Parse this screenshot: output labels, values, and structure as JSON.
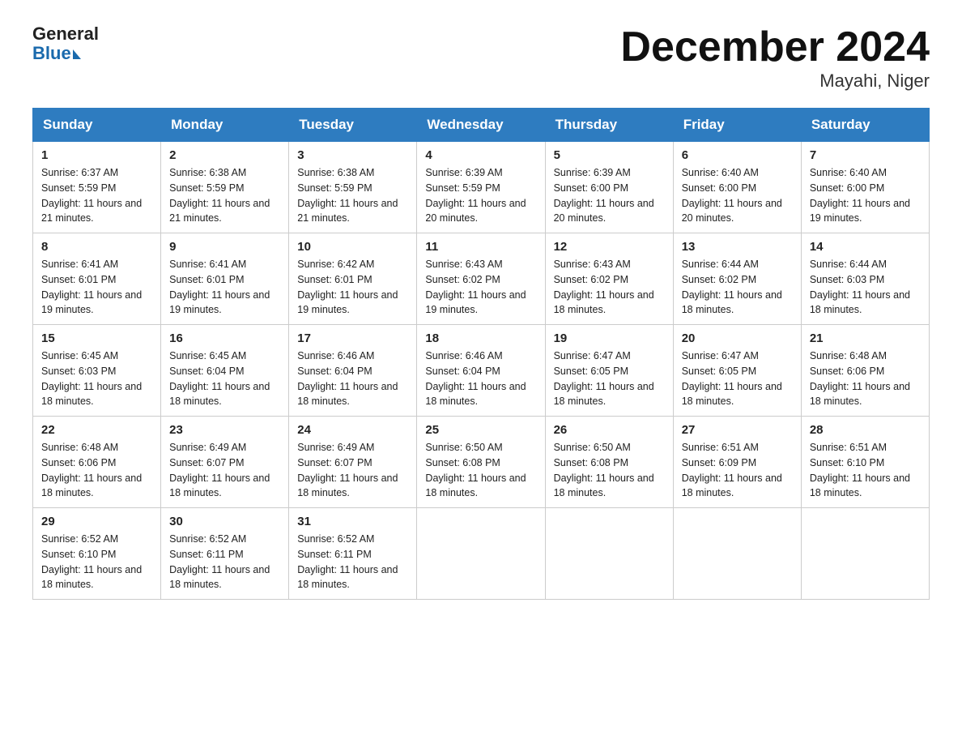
{
  "logo": {
    "general": "General",
    "blue": "Blue"
  },
  "title": "December 2024",
  "location": "Mayahi, Niger",
  "weekdays": [
    "Sunday",
    "Monday",
    "Tuesday",
    "Wednesday",
    "Thursday",
    "Friday",
    "Saturday"
  ],
  "weeks": [
    [
      {
        "day": "1",
        "sunrise": "6:37 AM",
        "sunset": "5:59 PM",
        "daylight": "11 hours and 21 minutes."
      },
      {
        "day": "2",
        "sunrise": "6:38 AM",
        "sunset": "5:59 PM",
        "daylight": "11 hours and 21 minutes."
      },
      {
        "day": "3",
        "sunrise": "6:38 AM",
        "sunset": "5:59 PM",
        "daylight": "11 hours and 21 minutes."
      },
      {
        "day": "4",
        "sunrise": "6:39 AM",
        "sunset": "5:59 PM",
        "daylight": "11 hours and 20 minutes."
      },
      {
        "day": "5",
        "sunrise": "6:39 AM",
        "sunset": "6:00 PM",
        "daylight": "11 hours and 20 minutes."
      },
      {
        "day": "6",
        "sunrise": "6:40 AM",
        "sunset": "6:00 PM",
        "daylight": "11 hours and 20 minutes."
      },
      {
        "day": "7",
        "sunrise": "6:40 AM",
        "sunset": "6:00 PM",
        "daylight": "11 hours and 19 minutes."
      }
    ],
    [
      {
        "day": "8",
        "sunrise": "6:41 AM",
        "sunset": "6:01 PM",
        "daylight": "11 hours and 19 minutes."
      },
      {
        "day": "9",
        "sunrise": "6:41 AM",
        "sunset": "6:01 PM",
        "daylight": "11 hours and 19 minutes."
      },
      {
        "day": "10",
        "sunrise": "6:42 AM",
        "sunset": "6:01 PM",
        "daylight": "11 hours and 19 minutes."
      },
      {
        "day": "11",
        "sunrise": "6:43 AM",
        "sunset": "6:02 PM",
        "daylight": "11 hours and 19 minutes."
      },
      {
        "day": "12",
        "sunrise": "6:43 AM",
        "sunset": "6:02 PM",
        "daylight": "11 hours and 18 minutes."
      },
      {
        "day": "13",
        "sunrise": "6:44 AM",
        "sunset": "6:02 PM",
        "daylight": "11 hours and 18 minutes."
      },
      {
        "day": "14",
        "sunrise": "6:44 AM",
        "sunset": "6:03 PM",
        "daylight": "11 hours and 18 minutes."
      }
    ],
    [
      {
        "day": "15",
        "sunrise": "6:45 AM",
        "sunset": "6:03 PM",
        "daylight": "11 hours and 18 minutes."
      },
      {
        "day": "16",
        "sunrise": "6:45 AM",
        "sunset": "6:04 PM",
        "daylight": "11 hours and 18 minutes."
      },
      {
        "day": "17",
        "sunrise": "6:46 AM",
        "sunset": "6:04 PM",
        "daylight": "11 hours and 18 minutes."
      },
      {
        "day": "18",
        "sunrise": "6:46 AM",
        "sunset": "6:04 PM",
        "daylight": "11 hours and 18 minutes."
      },
      {
        "day": "19",
        "sunrise": "6:47 AM",
        "sunset": "6:05 PM",
        "daylight": "11 hours and 18 minutes."
      },
      {
        "day": "20",
        "sunrise": "6:47 AM",
        "sunset": "6:05 PM",
        "daylight": "11 hours and 18 minutes."
      },
      {
        "day": "21",
        "sunrise": "6:48 AM",
        "sunset": "6:06 PM",
        "daylight": "11 hours and 18 minutes."
      }
    ],
    [
      {
        "day": "22",
        "sunrise": "6:48 AM",
        "sunset": "6:06 PM",
        "daylight": "11 hours and 18 minutes."
      },
      {
        "day": "23",
        "sunrise": "6:49 AM",
        "sunset": "6:07 PM",
        "daylight": "11 hours and 18 minutes."
      },
      {
        "day": "24",
        "sunrise": "6:49 AM",
        "sunset": "6:07 PM",
        "daylight": "11 hours and 18 minutes."
      },
      {
        "day": "25",
        "sunrise": "6:50 AM",
        "sunset": "6:08 PM",
        "daylight": "11 hours and 18 minutes."
      },
      {
        "day": "26",
        "sunrise": "6:50 AM",
        "sunset": "6:08 PM",
        "daylight": "11 hours and 18 minutes."
      },
      {
        "day": "27",
        "sunrise": "6:51 AM",
        "sunset": "6:09 PM",
        "daylight": "11 hours and 18 minutes."
      },
      {
        "day": "28",
        "sunrise": "6:51 AM",
        "sunset": "6:10 PM",
        "daylight": "11 hours and 18 minutes."
      }
    ],
    [
      {
        "day": "29",
        "sunrise": "6:52 AM",
        "sunset": "6:10 PM",
        "daylight": "11 hours and 18 minutes."
      },
      {
        "day": "30",
        "sunrise": "6:52 AM",
        "sunset": "6:11 PM",
        "daylight": "11 hours and 18 minutes."
      },
      {
        "day": "31",
        "sunrise": "6:52 AM",
        "sunset": "6:11 PM",
        "daylight": "11 hours and 18 minutes."
      },
      null,
      null,
      null,
      null
    ]
  ]
}
